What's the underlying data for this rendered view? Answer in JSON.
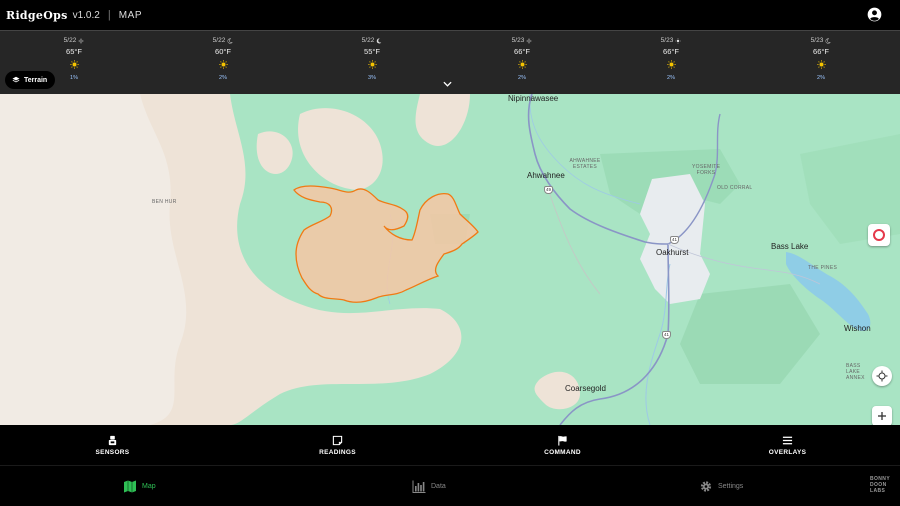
{
  "app": {
    "brand": "RidgeOps",
    "version": "v1.0.2",
    "page": "MAP"
  },
  "weather": [
    {
      "date": "5/22",
      "period_icon": "sun-icon",
      "temp": "65°F",
      "precip": "1%"
    },
    {
      "date": "5/22",
      "period_icon": "moon-icon",
      "temp": "60°F",
      "precip": "2%"
    },
    {
      "date": "5/22",
      "period_icon": "moon-icon",
      "temp": "55°F",
      "precip": "3%"
    },
    {
      "date": "5/23",
      "period_icon": "sun-icon",
      "temp": "66°F",
      "precip": "2%"
    },
    {
      "date": "5/23",
      "period_icon": "sun-icon",
      "temp": "66°F",
      "precip": "2%"
    },
    {
      "date": "5/23",
      "period_icon": "moon-icon",
      "temp": "66°F",
      "precip": "2%"
    }
  ],
  "terrain_button": {
    "label": "Terrain",
    "icon": "layers-icon"
  },
  "map": {
    "places": [
      {
        "name": "Nipinnawasee"
      },
      {
        "name": "AHWAHNEE ESTATES"
      },
      {
        "name": "Ahwahnee"
      },
      {
        "name": "YOSEMITE FORKS"
      },
      {
        "name": "OLD CORRAL"
      },
      {
        "name": "BEN HUR"
      },
      {
        "name": "Oakhurst"
      },
      {
        "name": "Bass Lake"
      },
      {
        "name": "THE PINES"
      },
      {
        "name": "Wishon"
      },
      {
        "name": "BASS LAKE ANNEX"
      },
      {
        "name": "Coarsegold"
      }
    ],
    "route_shields": [
      "49",
      "41",
      "41"
    ],
    "colors": {
      "terrain": "#a9e4c4",
      "fire_fill": "#f6c7a4",
      "fire_stroke": "#f07a14",
      "water": "#8fcde6",
      "road": "#8a95c6"
    }
  },
  "actions": [
    {
      "label": "SENSORS",
      "icon": "sensor-icon"
    },
    {
      "label": "READINGS",
      "icon": "notepad-icon"
    },
    {
      "label": "COMMAND",
      "icon": "flag-icon"
    },
    {
      "label": "OVERLAYS",
      "icon": "menu-icon"
    }
  ],
  "nav": [
    {
      "label": "Map",
      "icon": "map-icon",
      "active": true,
      "color": "#2fbf55"
    },
    {
      "label": "Data",
      "icon": "bar-chart-icon",
      "active": false
    },
    {
      "label": "Settings",
      "icon": "gear-icon",
      "active": false
    }
  ],
  "company": {
    "line1": "BONNY",
    "line2": "DOON",
    "line3": "LABS"
  }
}
